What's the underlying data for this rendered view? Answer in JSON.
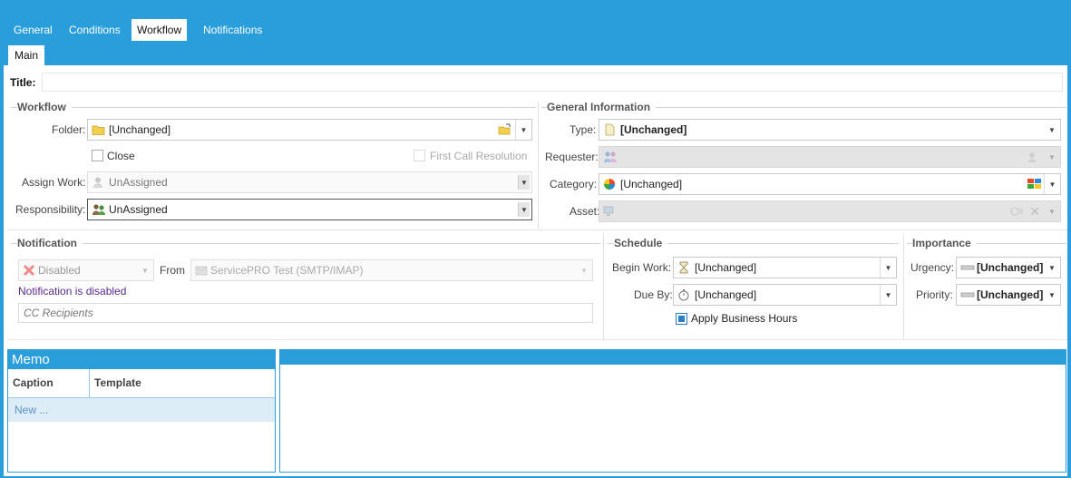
{
  "tabs": [
    {
      "label": "General"
    },
    {
      "label": "Conditions"
    },
    {
      "label": "Workflow"
    },
    {
      "label": "Notifications"
    }
  ],
  "active_tab": "Workflow",
  "subtab": {
    "label": "Main"
  },
  "title_label": "Title:",
  "workflow": {
    "section": "Workflow",
    "folder_label": "Folder:",
    "folder_value": "[Unchanged]",
    "close_label": "Close",
    "first_call_label": "First Call Resolution",
    "assign_label": "Assign Work:",
    "assign_value": "UnAssigned",
    "responsibility_label": "Responsibility:",
    "responsibility_value": "UnAssigned"
  },
  "general_info": {
    "section": "General Information",
    "type_label": "Type:",
    "type_value": "[Unchanged]",
    "requester_label": "Requester:",
    "category_label": "Category:",
    "category_value": "[Unchanged]",
    "asset_label": "Asset:"
  },
  "notification": {
    "section": "Notification",
    "status_value": "Disabled",
    "from_label": "From",
    "from_value": "ServicePRO Test (SMTP/IMAP)",
    "disabled_message": "Notification is disabled",
    "cc_placeholder": "CC Recipients"
  },
  "schedule": {
    "section": "Schedule",
    "begin_label": "Begin Work:",
    "begin_value": "[Unchanged]",
    "due_label": "Due By:",
    "due_value": "[Unchanged]",
    "business_hours_label": "Apply Business Hours"
  },
  "importance": {
    "section": "Importance",
    "urgency_label": "Urgency:",
    "urgency_value": "[Unchanged]",
    "priority_label": "Priority:",
    "priority_value": "[Unchanged]"
  },
  "memo": {
    "title": "Memo",
    "columns": [
      "Caption",
      "Template"
    ],
    "new_row": "New ..."
  },
  "colors": {
    "accent": "#2a9edb",
    "message": "#5a2a8a"
  }
}
